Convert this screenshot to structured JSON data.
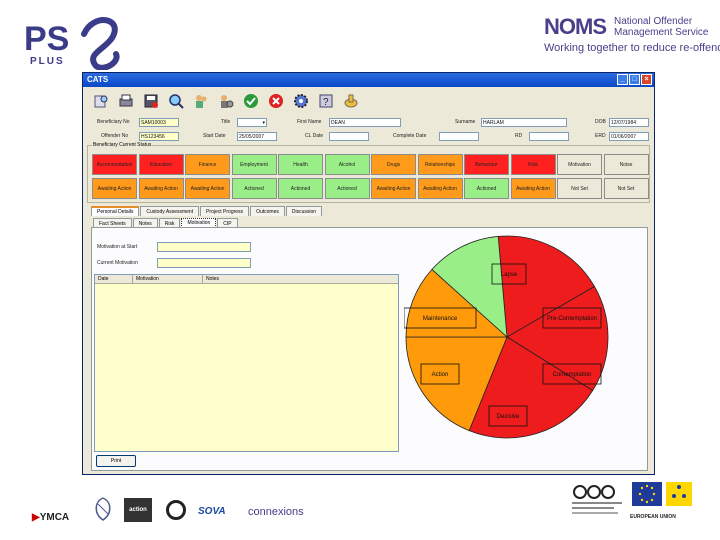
{
  "header": {
    "ps_logo": "PS",
    "ps_logo_sub": "PLUS",
    "noms_logo": "NOMS",
    "noms_name_line1": "National Offender",
    "noms_name_line2": "Management Service",
    "noms_tagline": "Working together to reduce re-offending"
  },
  "window": {
    "title": "CATS",
    "toolbar_icons": [
      "find-icon",
      "print-icon",
      "save-icon",
      "search-icon",
      "users-icon",
      "settings-users-icon",
      "accept-icon",
      "cancel-icon",
      "gear-icon",
      "help-icon",
      "hand-icon"
    ]
  },
  "fields": {
    "beneficiary_no_label": "Beneficiary No",
    "beneficiary_no": "SAM10003",
    "title_label": "Title",
    "first_name_label": "First Name",
    "first_name": "DEAN",
    "surname_label": "Surname",
    "surname": "HARLAM",
    "dob_label": "DOB",
    "dob": "12/07/1984",
    "offender_no_label": "Offender No",
    "offender_no": "HS123456",
    "start_date_label": "Start Date",
    "start_date": "25/05/2007",
    "cl_date_label": "CL Date",
    "complete_date_label": "Complete Date",
    "rd_label": "RD",
    "erd_label": "ERD",
    "erd": "01/06/2007"
  },
  "status": {
    "group_title": "Beneficiary Current Status",
    "rows": [
      [
        {
          "label": "Accommodation",
          "color": "#ff2020"
        },
        {
          "label": "Education",
          "color": "#ff2020"
        },
        {
          "label": "Finance",
          "color": "#ff9a1a"
        },
        {
          "label": "Employment",
          "color": "#99ee88"
        },
        {
          "label": "Health",
          "color": "#99ee88"
        },
        {
          "label": "Alcohol",
          "color": "#99ee88"
        },
        {
          "label": "Drugs",
          "color": "#ff9a1a"
        },
        {
          "label": "Relationships",
          "color": "#ff9a1a"
        },
        {
          "label": "Behaviour",
          "color": "#ff2020"
        },
        {
          "label": "Risk",
          "color": "#ff2020"
        },
        {
          "label": "Motivation",
          "color": "#ece9d8"
        },
        {
          "label": "Noise",
          "color": "#ece9d8"
        }
      ],
      [
        {
          "label": "Awaiting Action",
          "color": "#ff9a1a"
        },
        {
          "label": "Awaiting Action",
          "color": "#ff9a1a"
        },
        {
          "label": "Awaiting Action",
          "color": "#ff9a1a"
        },
        {
          "label": "Actioned",
          "color": "#99ee88"
        },
        {
          "label": "Actioned",
          "color": "#99ee88"
        },
        {
          "label": "Actioned",
          "color": "#99ee88"
        },
        {
          "label": "Awaiting Action",
          "color": "#ff9a1a"
        },
        {
          "label": "Awaiting Action",
          "color": "#ff9a1a"
        },
        {
          "label": "Actioned",
          "color": "#99ee88"
        },
        {
          "label": "Awaiting Action",
          "color": "#ff9a1a"
        },
        {
          "label": "Not Set",
          "color": "#ece9d8"
        },
        {
          "label": "Not Set",
          "color": "#ece9d8"
        }
      ]
    ]
  },
  "tabs": {
    "main": [
      "Personal Details",
      "Custody Assessment",
      "Project Progress",
      "Outcomes",
      "Discussion"
    ],
    "sub": [
      "Fact Sheets",
      "Notes",
      "Risk",
      "Motivation",
      "CIP"
    ]
  },
  "motivation": {
    "at_start_label": "Motivation at Start",
    "current_label": "Current Motivation",
    "grid_headers": [
      "Date",
      "Motivation",
      "Notes"
    ],
    "print_label": "Print"
  },
  "cycle": {
    "segments": [
      {
        "label": "Lapse",
        "color": "#ee1c1c"
      },
      {
        "label": "Pre-Contemplation",
        "color": "#ee1c1c"
      },
      {
        "label": "Contemplation",
        "color": "#ee1c1c"
      },
      {
        "label": "Decisive",
        "color": "#ff9a0a"
      },
      {
        "label": "Action",
        "color": "#ff9a0a"
      },
      {
        "label": "Maintenance",
        "color": "#99ee88"
      }
    ]
  },
  "footer": {
    "logos": [
      "YMCA",
      "action",
      "SOVA",
      "connexions",
      "EUROPEAN UNION"
    ]
  }
}
